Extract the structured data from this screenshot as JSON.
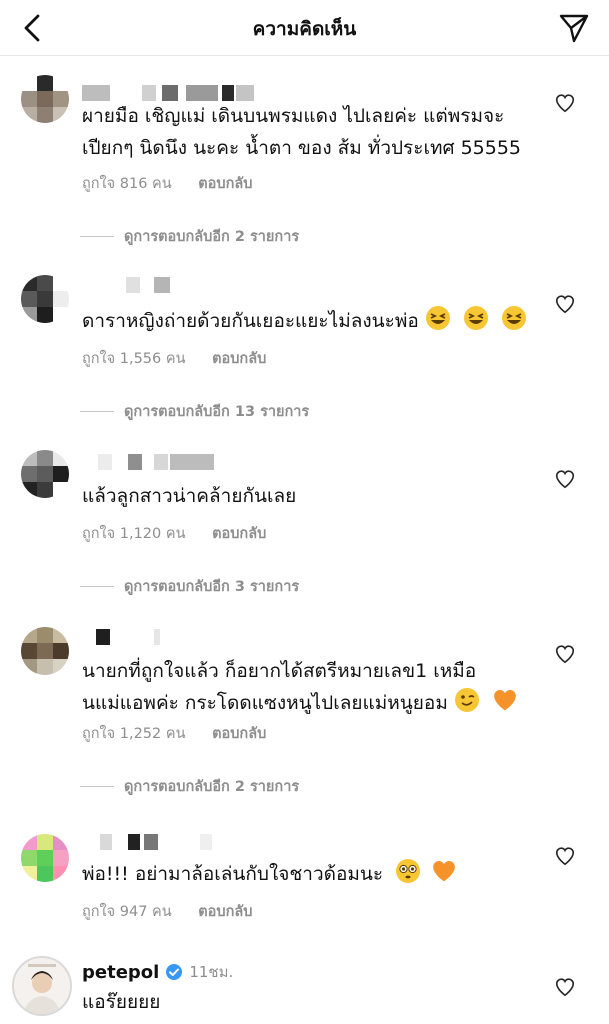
{
  "header": {
    "title": "ความคิดเห็น",
    "back_icon": "chevron-left-icon",
    "send_icon": "paper-plane-icon"
  },
  "comments": [
    {
      "text_line1": "ผายมือ เชิญแม่ เดินบนพรมแดง ไปเลยค่ะ แต่พรมจะ",
      "text_line2": "เปียกๆ นิดนึง นะคะ น้ำตา ของ ส้ม ทั่วประเทศ 55555",
      "likes": "ถูกใจ 816 คน",
      "reply": "ตอบกลับ",
      "view_replies": "ดูการตอบกลับอีก 2 รายการ"
    },
    {
      "text_line1": "ดาราหญิงถ่ายด้วยกันเยอะแยะไม่ลงนะพ่อ",
      "likes": "ถูกใจ 1,556 คน",
      "reply": "ตอบกลับ",
      "view_replies": "ดูการตอบกลับอีก 13 รายการ"
    },
    {
      "text_line1": "แล้วลูกสาวน่าคล้ายกันเลย",
      "likes": "ถูกใจ 1,120 คน",
      "reply": "ตอบกลับ",
      "view_replies": "ดูการตอบกลับอีก 3 รายการ"
    },
    {
      "text_line1": "นายกที่ถูกใจแล้ว ก็อยากได้สตรีหมายเลข1 เหมือ",
      "text_line2": "นแม่แอพค่ะ  กระโดดแซงหนูไปเลยแม่หนูยอม",
      "likes": "ถูกใจ 1,252 คน",
      "reply": "ตอบกลับ",
      "view_replies": "ดูการตอบกลับอีก 2 รายการ"
    },
    {
      "text_line1": "พ่อ!!! อย่ามาล้อเล่นกับใจชาวด้อมนะ",
      "likes": "ถูกใจ 947 คน",
      "reply": "ตอบกลับ"
    },
    {
      "username": "petepol",
      "time": "11ชม.",
      "text_line1": "แอร๊ยยยย"
    }
  ],
  "colors": {
    "accent_blue": "#3897f0",
    "meta_gray": "#8e8e8e",
    "heart_orange": "#f5922a"
  }
}
